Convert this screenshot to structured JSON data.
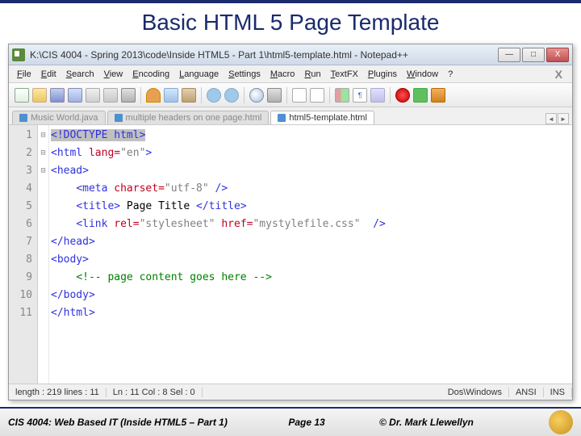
{
  "slide": {
    "title": "Basic HTML 5 Page Template"
  },
  "window": {
    "title": "K:\\CIS 4004 - Spring 2013\\code\\Inside HTML5 - Part 1\\html5-template.html - Notepad++",
    "buttons": {
      "min": "—",
      "max": "□",
      "close": "X"
    }
  },
  "menu": [
    "File",
    "Edit",
    "Search",
    "View",
    "Encoding",
    "Language",
    "Settings",
    "Macro",
    "Run",
    "TextFX",
    "Plugins",
    "Window",
    "?"
  ],
  "tabs": {
    "items": [
      {
        "label": "Music World.java",
        "active": false
      },
      {
        "label": "multiple headers on one page.html",
        "active": false
      },
      {
        "label": "html5-template.html",
        "active": true
      }
    ]
  },
  "code": {
    "line_numbers": [
      "1",
      "2",
      "3",
      "4",
      "5",
      "6",
      "7",
      "8",
      "9",
      "10",
      "11"
    ],
    "folds": [
      "",
      "⊟",
      "⊟",
      "",
      "",
      "",
      "",
      "⊟",
      "",
      "",
      ""
    ],
    "lines": [
      {
        "indent": 0,
        "sel": true,
        "parts": [
          [
            "tag",
            "<!DOCTYPE html>"
          ]
        ]
      },
      {
        "indent": 0,
        "parts": [
          [
            "tag",
            "<html "
          ],
          [
            "attr",
            "lang="
          ],
          [
            "str",
            "\"en\""
          ],
          [
            "tag",
            ">"
          ]
        ]
      },
      {
        "indent": 0,
        "parts": [
          [
            "tag",
            "<head>"
          ]
        ]
      },
      {
        "indent": 1,
        "parts": [
          [
            "tag",
            "<meta "
          ],
          [
            "attr",
            "charset="
          ],
          [
            "str",
            "\"utf-8\""
          ],
          [
            "tag",
            " />"
          ]
        ]
      },
      {
        "indent": 1,
        "parts": [
          [
            "tag",
            "<title>"
          ],
          [
            "txt",
            " Page Title "
          ],
          [
            "tag",
            "</title>"
          ]
        ]
      },
      {
        "indent": 1,
        "parts": [
          [
            "tag",
            "<link "
          ],
          [
            "attr",
            "rel="
          ],
          [
            "str",
            "\"stylesheet\""
          ],
          [
            "tag",
            " "
          ],
          [
            "attr",
            "href="
          ],
          [
            "str",
            "\"mystylefile.css\""
          ],
          [
            "tag",
            "  />"
          ]
        ]
      },
      {
        "indent": 0,
        "parts": [
          [
            "tag",
            "</head>"
          ]
        ]
      },
      {
        "indent": 0,
        "parts": [
          [
            "tag",
            "<body>"
          ]
        ]
      },
      {
        "indent": 1,
        "parts": [
          [
            "cmt",
            "<!-- page content goes here -->"
          ]
        ]
      },
      {
        "indent": 0,
        "parts": [
          [
            "tag",
            "</body>"
          ]
        ]
      },
      {
        "indent": 0,
        "parts": [
          [
            "tag",
            "</html>"
          ]
        ]
      }
    ]
  },
  "status": {
    "length": "length : 219    lines : 11",
    "pos": "Ln : 11    Col : 8    Sel : 0",
    "eol": "Dos\\Windows",
    "enc": "ANSI",
    "mode": "INS"
  },
  "footer": {
    "course": "CIS 4004: Web Based IT (Inside HTML5 – Part 1)",
    "page": "Page 13",
    "copyright": "© Dr. Mark Llewellyn"
  }
}
